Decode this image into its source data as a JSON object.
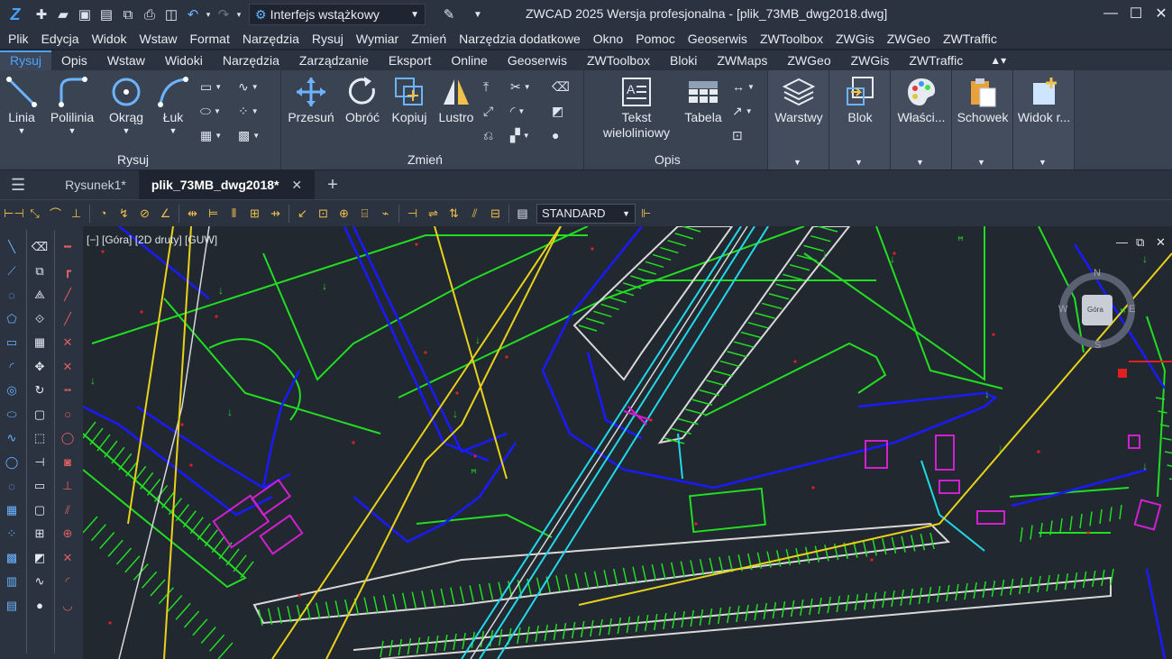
{
  "title": {
    "window_title": "ZWCAD 2025 Wersja profesjonalna - [plik_73MB_dwg2018.dwg]",
    "workspace": "Interfejs wstążkowy"
  },
  "menu": [
    "Plik",
    "Edycja",
    "Widok",
    "Wstaw",
    "Format",
    "Narzędzia",
    "Rysuj",
    "Wymiar",
    "Zmień",
    "Narzędzia dodatkowe",
    "Okno",
    "Pomoc",
    "Geoserwis",
    "ZWToolbox",
    "ZWGis",
    "ZWGeo",
    "ZWTraffic"
  ],
  "ribbon_tabs": [
    "Rysuj",
    "Opis",
    "Wstaw",
    "Widoki",
    "Narzędzia",
    "Zarządzanie",
    "Eksport",
    "Online",
    "Geoserwis",
    "ZWToolbox",
    "Bloki",
    "ZWMaps",
    "ZWGeo",
    "ZWGis",
    "ZWTraffic"
  ],
  "ribbon": {
    "rysuj": {
      "title": "Rysuj",
      "linia": "Linia",
      "polilinia": "Polilinia",
      "okrag": "Okrąg",
      "luk": "Łuk"
    },
    "zmien": {
      "title": "Zmień",
      "przesun": "Przesuń",
      "obroc": "Obróć",
      "kopiuj": "Kopiuj",
      "lustro": "Lustro"
    },
    "opis": {
      "title": "Opis",
      "tekst_line1": "Tekst",
      "tekst_line2": "wieloliniowy",
      "tabela": "Tabela"
    },
    "warstwy": "Warstwy",
    "blok": "Blok",
    "wlasci": "Właści...",
    "schowek": "Schowek",
    "widok": "Widok r..."
  },
  "doc_tabs": {
    "tab1": "Rysunek1*",
    "tab2": "plik_73MB_dwg2018*"
  },
  "dim_style": "STANDARD",
  "viewport": {
    "label": "[−] [Góra] [2D druty] [GUW]",
    "compass": {
      "n": "N",
      "s": "S",
      "w": "W",
      "e": "E",
      "face": "Góra"
    }
  },
  "colors": {
    "accent": "#4aa3ff",
    "canvas_bg": "#212830",
    "line_green": "#22dd22",
    "line_blue": "#1a1aff",
    "line_yellow": "#e8d21a",
    "line_cyan": "#22d8e8",
    "line_magenta": "#d020d0",
    "line_white": "#d8d8d8"
  }
}
